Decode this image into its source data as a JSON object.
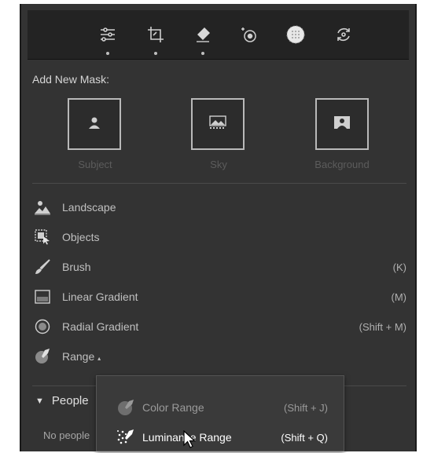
{
  "toolbar": {
    "tools": [
      {
        "icon": "sliders-icon",
        "has_dot": true
      },
      {
        "icon": "crop-icon",
        "has_dot": true
      },
      {
        "icon": "eraser-icon",
        "has_dot": true
      },
      {
        "icon": "red-eye-icon",
        "has_dot": false
      },
      {
        "icon": "masking-icon",
        "has_dot": false,
        "active": true
      },
      {
        "icon": "presets-icon",
        "has_dot": false
      }
    ]
  },
  "add_mask": {
    "title": "Add New Mask:",
    "tiles": [
      {
        "label": "Subject",
        "icon": "subject-icon"
      },
      {
        "label": "Sky",
        "icon": "sky-icon"
      },
      {
        "label": "Background",
        "icon": "background-icon"
      }
    ]
  },
  "tools_list": [
    {
      "label": "Landscape",
      "shortcut": "",
      "icon": "landscape-icon"
    },
    {
      "label": "Objects",
      "shortcut": "",
      "icon": "objects-icon"
    },
    {
      "label": "Brush",
      "shortcut": "(K)",
      "icon": "brush-icon"
    },
    {
      "label": "Linear Gradient",
      "shortcut": "(M)",
      "icon": "linear-gradient-icon"
    },
    {
      "label": "Radial Gradient",
      "shortcut": "(Shift + M)",
      "icon": "radial-gradient-icon"
    },
    {
      "label": "Range",
      "shortcut": "",
      "icon": "range-icon",
      "has_submenu": true
    }
  ],
  "people": {
    "title": "People",
    "empty_text": "No people"
  },
  "range_menu": {
    "items": [
      {
        "label": "Color Range",
        "shortcut": "(Shift + J)",
        "icon": "color-range-icon",
        "dimmed": true
      },
      {
        "label": "Luminance Range",
        "shortcut": "(Shift + Q)",
        "icon": "luminance-range-icon",
        "dimmed": false
      }
    ]
  },
  "colors": {
    "panel_bg": "#333333",
    "toolbar_bg": "#232323",
    "menu_bg": "#3a3a3a",
    "dimmed_text": "#9a9a9a",
    "bright_text": "#ffffff"
  }
}
